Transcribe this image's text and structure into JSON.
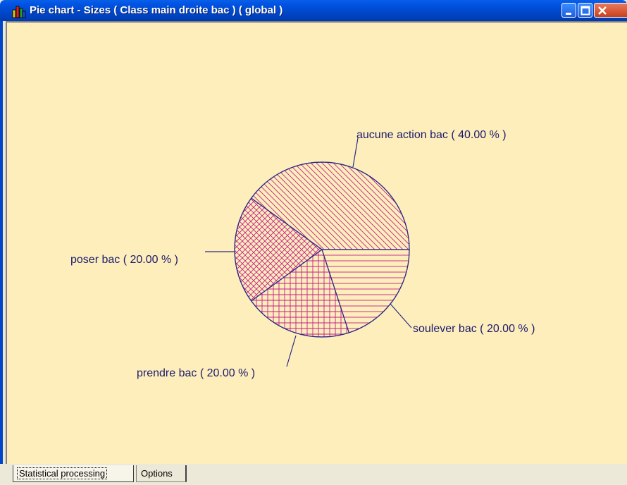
{
  "window": {
    "title": "Pie chart - Sizes ( Class main droite bac ) ( global )",
    "icon": "bar-chart-app-icon",
    "controls": [
      "minimize-icon",
      "maximize-icon",
      "close-icon"
    ]
  },
  "colors": {
    "background": "#FEEEBB",
    "outline": "#2A2A8A",
    "hatch": "#C0208A",
    "titlebar": "#0054E3"
  },
  "chart_data": {
    "type": "pie",
    "slices": [
      {
        "label": "aucune action bac ( 40.00 % )",
        "category": "aucune action bac",
        "value": 40.0,
        "pattern": "diagonal"
      },
      {
        "label": "soulever bac ( 20.00 % )",
        "category": "soulever bac",
        "value": 20.0,
        "pattern": "crosshatch-diagonal"
      },
      {
        "label": "prendre bac ( 20.00 % )",
        "category": "prendre bac",
        "value": 20.0,
        "pattern": "grid"
      },
      {
        "label": "poser bac ( 20.00 % )",
        "category": "poser bac",
        "value": 20.0,
        "pattern": "horizontal"
      }
    ]
  },
  "tabs": [
    {
      "label": "Statistical processing",
      "active": true
    },
    {
      "label": "Options",
      "active": false
    }
  ]
}
